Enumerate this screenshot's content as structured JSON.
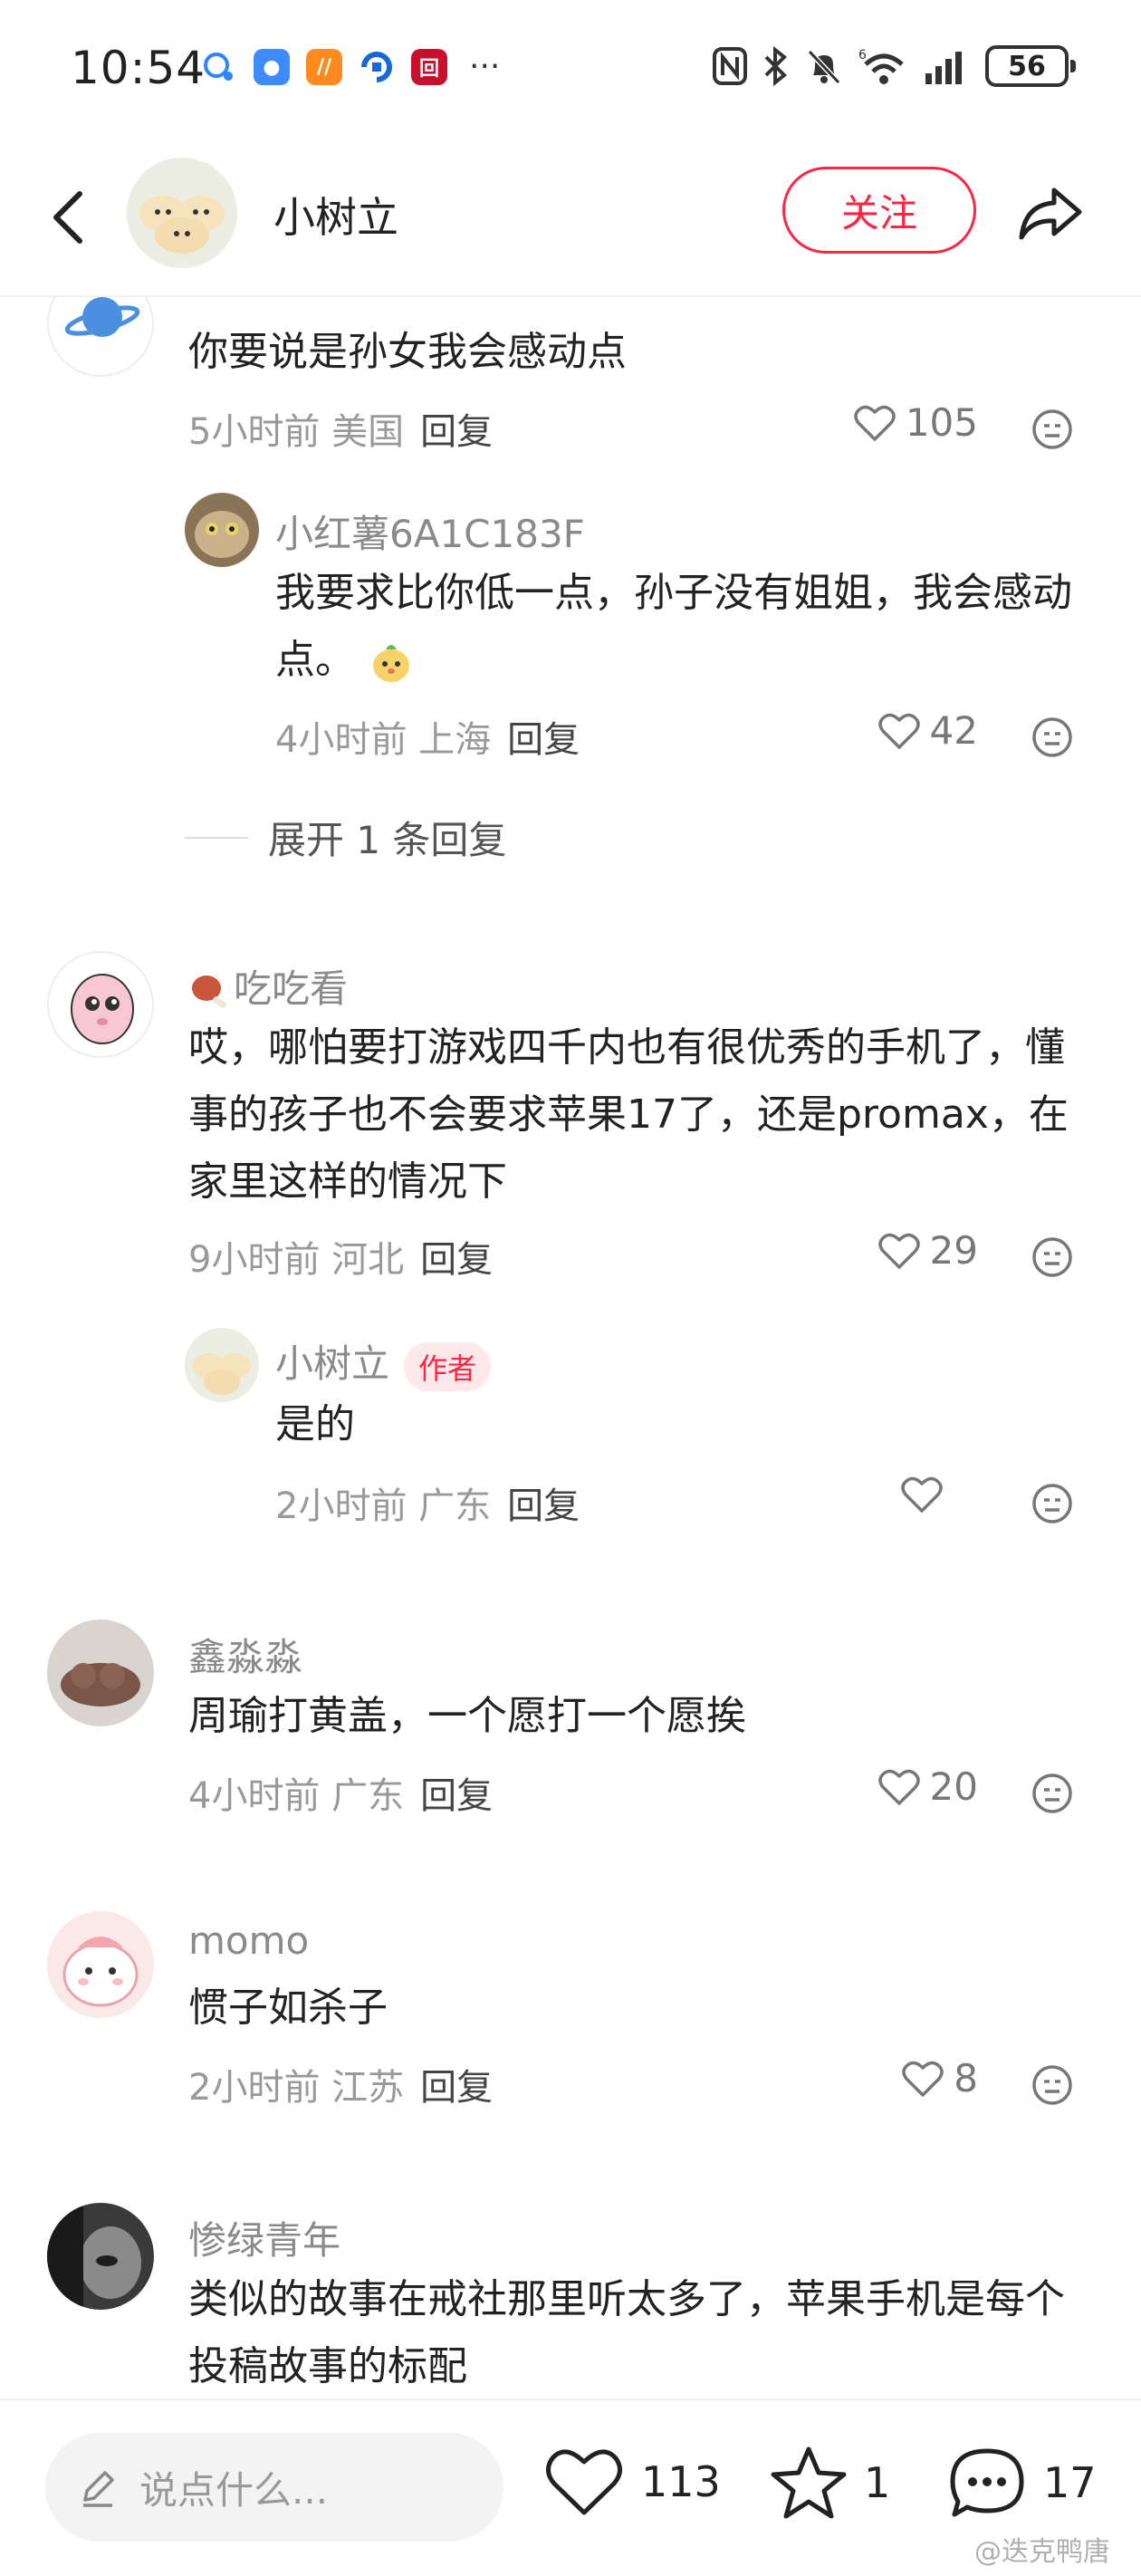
{
  "status": {
    "time": "10:54",
    "battery": "56",
    "network": "6G"
  },
  "header": {
    "username": "小树立",
    "follow_label": "关注"
  },
  "comments": [
    {
      "user": "",
      "text": "你要说是孙女我会感动点",
      "time": "5小时前",
      "location": "美国",
      "reply_label": "回复",
      "likes": "105"
    },
    {
      "user": "小红薯6A1C183F",
      "text": "我要求比你低一点，孙子没有姐姐，我会感动点。",
      "time": "4小时前",
      "location": "上海",
      "reply_label": "回复",
      "likes": "42"
    },
    {
      "expand_label": "展开 1 条回复"
    },
    {
      "user": "吃吃看",
      "text": "哎，哪怕要打游戏四千内也有很优秀的手机了，懂事的孩子也不会要求苹果17了，还是promax，在家里这样的情况下",
      "time": "9小时前",
      "location": "河北",
      "reply_label": "回复",
      "likes": "29"
    },
    {
      "user": "小树立",
      "badge": "作者",
      "text": "是的",
      "time": "2小时前",
      "location": "广东",
      "reply_label": "回复",
      "likes": ""
    },
    {
      "user": "鑫淼淼",
      "text": "周瑜打黄盖，一个愿打一个愿挨",
      "time": "4小时前",
      "location": "广东",
      "reply_label": "回复",
      "likes": "20"
    },
    {
      "user": "momo",
      "text": "惯子如杀子",
      "time": "2小时前",
      "location": "江苏",
      "reply_label": "回复",
      "likes": "8"
    },
    {
      "user": "惨绿青年",
      "text": "类似的故事在戒社那里听太多了，苹果手机是每个投稿故事的标配"
    }
  ],
  "bottom": {
    "input_placeholder": "说点什么...",
    "likes": "113",
    "collects": "1",
    "comments": "17",
    "watermark": "@迭克鸭唐"
  },
  "colors": {
    "accent": "#ff2442",
    "meta": "#999999",
    "username": "#8a8a8a"
  }
}
